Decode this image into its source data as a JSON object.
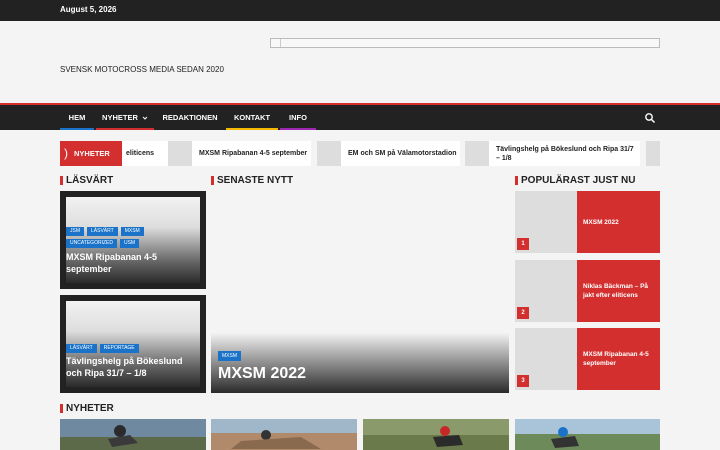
{
  "topbar": {
    "date": "August 5, 2026"
  },
  "header": {
    "tagline": "SVENSK MOTOCROSS MEDIA SEDAN 2020"
  },
  "nav": {
    "items": [
      {
        "label": "HEM",
        "color": "#1a73c9"
      },
      {
        "label": "NYHETER",
        "color": "#d32f2f"
      },
      {
        "label": "REDAKTIONEN",
        "color": ""
      },
      {
        "label": "KONTAKT",
        "color": "#f5b800"
      },
      {
        "label": "INFO",
        "color": "#9c27b0"
      }
    ],
    "dropdown_icon": "chevron-down-icon",
    "search_icon": "search-icon"
  },
  "ticker": {
    "label": "NYHETER",
    "items": [
      "eliticens",
      "MXSM Ripabanan 4-5 september",
      "EM och SM på Välamotorstadion",
      "Tävlingshelg på Bökeslund och Ripa 31/7 – 1/8"
    ]
  },
  "sections": {
    "lasvart": "LÄSVÄRT",
    "senaste": "SENASTE NYTT",
    "popularast": "POPULÄRAST JUST NU",
    "nyheter": "NYHETER"
  },
  "lasvart": [
    {
      "tags": [
        "JSM",
        "LÄSVÄRT",
        "MXSM",
        "UNCATEGORIZED",
        "USM"
      ],
      "title": "MXSM Ripabanan 4-5 september"
    },
    {
      "tags": [
        "LÄSVÄRT",
        "REPORTAGE"
      ],
      "title": "Tävlingshelg på Bökeslund och Ripa 31/7 – 1/8"
    }
  ],
  "senaste": {
    "tag": "MXSM",
    "title": "MXSM 2022"
  },
  "popular": [
    {
      "num": "1",
      "title": "MXSM 2022"
    },
    {
      "num": "2",
      "title": "Niklas Bäckman – På jakt efter eliticens"
    },
    {
      "num": "3",
      "title": "MXSM Ripabanan 4-5 september"
    }
  ],
  "colors": {
    "accent": "#d32f2f",
    "tag_blue": "#1a73c9",
    "dark": "#222222"
  }
}
